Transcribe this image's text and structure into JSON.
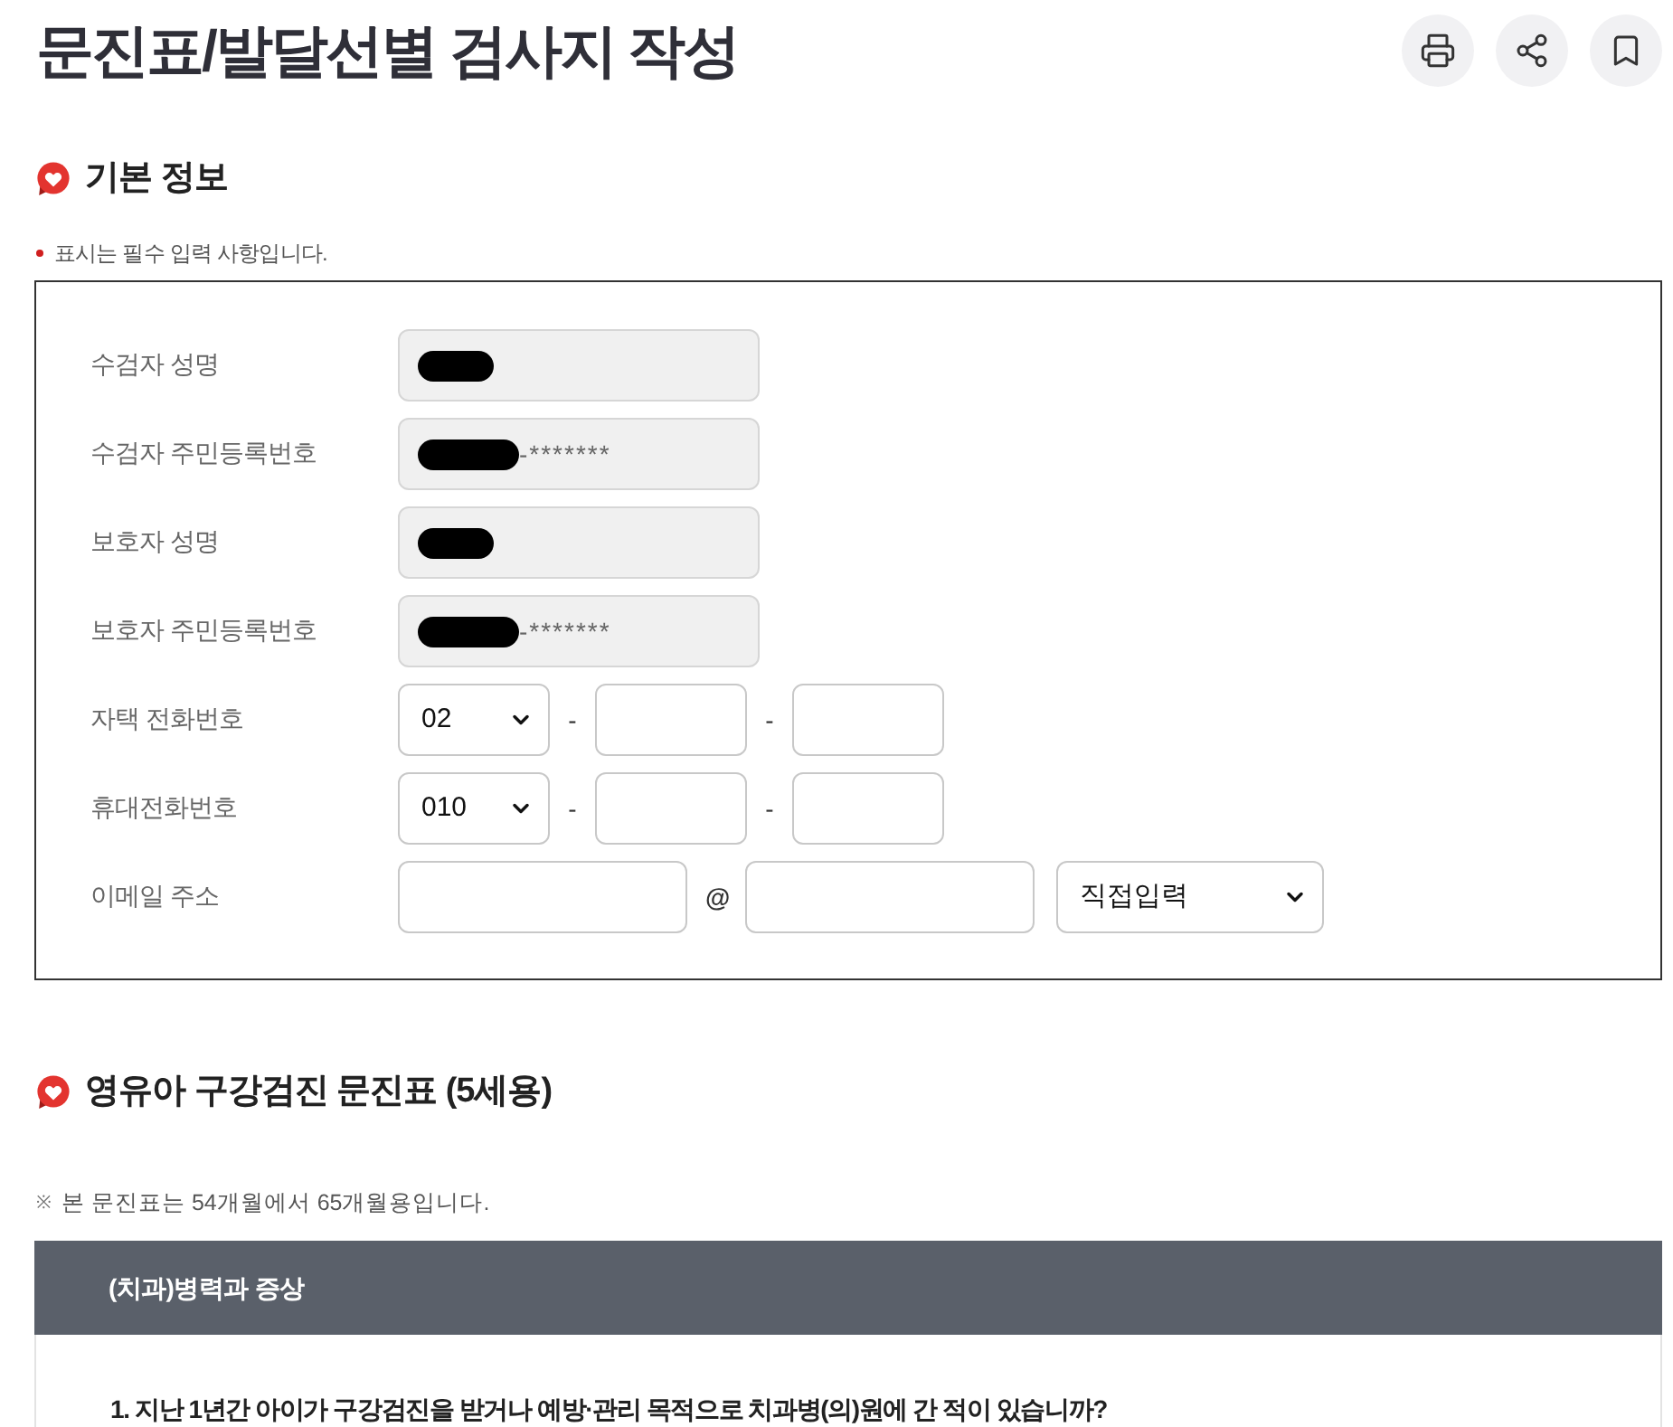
{
  "page": {
    "title": "문진표/발달선별 검사지 작성",
    "actions": [
      {
        "kind": "print"
      },
      {
        "kind": "share"
      },
      {
        "kind": "bookmark"
      }
    ]
  },
  "basic_info": {
    "heading": "기본 정보",
    "required_note": "표시는 필수 입력 사항입니다.",
    "fields": [
      {
        "label": "수검자 성명",
        "kind": "readonly",
        "redacted": true
      },
      {
        "label": "수검자 주민등록번호",
        "kind": "readonly",
        "redacted": true,
        "value": "-*******"
      },
      {
        "label": "보호자 성명",
        "kind": "readonly",
        "redacted": true
      },
      {
        "label": "보호자 주민등록번호",
        "kind": "readonly",
        "redacted": true,
        "value": "-*******"
      },
      {
        "label": "자택 전화번호",
        "kind": "phone",
        "parts": [
          {
            "kind": "select",
            "value": "02"
          },
          {
            "kind": "separator",
            "text": "-"
          },
          {
            "kind": "input"
          },
          {
            "kind": "separator",
            "text": "-"
          },
          {
            "kind": "input"
          }
        ]
      },
      {
        "label": "휴대전화번호",
        "kind": "phone",
        "parts": [
          {
            "kind": "select",
            "value": "010"
          },
          {
            "kind": "separator",
            "text": "-"
          },
          {
            "kind": "input"
          },
          {
            "kind": "separator",
            "text": "-"
          },
          {
            "kind": "input"
          }
        ]
      },
      {
        "label": "이메일 주소",
        "kind": "email",
        "parts": [
          {
            "kind": "input"
          },
          {
            "kind": "separator",
            "text": "@"
          },
          {
            "kind": "input"
          },
          {
            "kind": "select",
            "value": "직접입력"
          }
        ]
      }
    ]
  },
  "questionnaire": {
    "heading": "영유아 구강검진 문진표 (5세용)",
    "note_mark": "※",
    "note": "본 문진표는 54개월에서 65개월용입니다.",
    "sections": [
      {
        "title": "(치과)병력과 증상",
        "questions": [
          {
            "text": "1. 지난 1년간 아이가 구강검진을 받거나 예방·관리 목적으로 치과병(의)원에 간 적이 있습니까?"
          }
        ]
      }
    ]
  }
}
